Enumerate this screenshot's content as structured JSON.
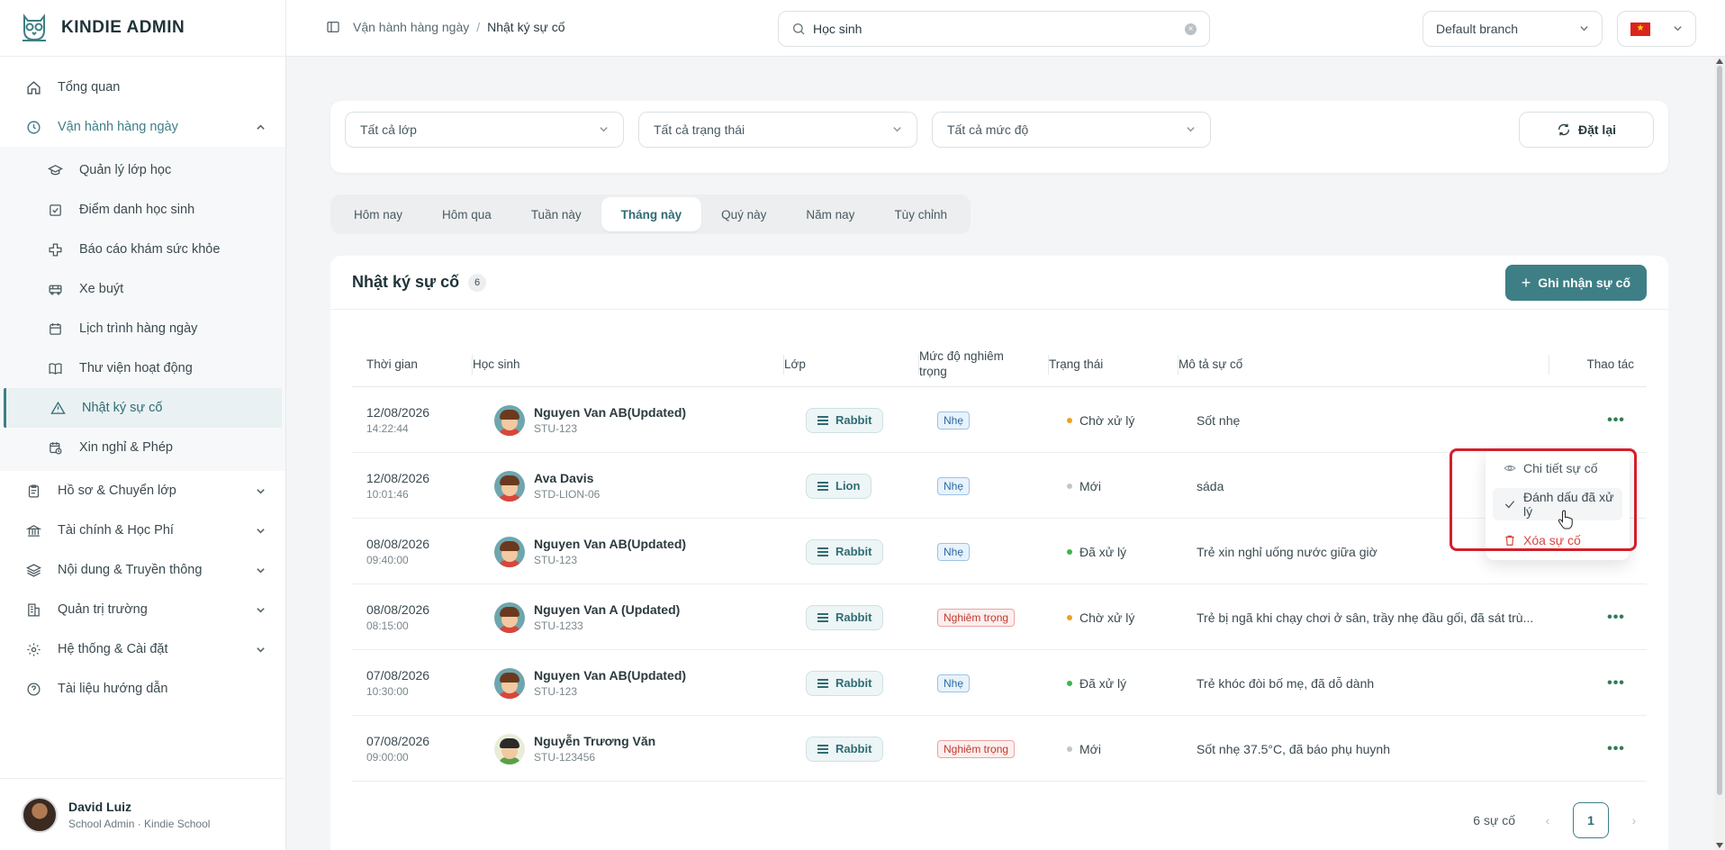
{
  "brand": {
    "name": "KINDIE ADMIN"
  },
  "sidebar": {
    "items": [
      {
        "label": "Tổng quan",
        "icon": "home-icon"
      },
      {
        "label": "Vận hành hàng ngày",
        "icon": "clock-icon",
        "open": true
      },
      {
        "label": "Hồ sơ & Chuyển lớp",
        "icon": "clipboard-icon"
      },
      {
        "label": "Tài chính & Học Phí",
        "icon": "bank-icon"
      },
      {
        "label": "Nội dung & Truyền thông",
        "icon": "layers-icon"
      },
      {
        "label": "Quản trị trường",
        "icon": "building-icon"
      },
      {
        "label": "Hệ thống & Cài đặt",
        "icon": "gear-icon"
      },
      {
        "label": "Tài liệu hướng dẫn",
        "icon": "help-icon"
      }
    ],
    "subitems": [
      {
        "label": "Quản lý lớp học",
        "icon": "graduation-cap-icon"
      },
      {
        "label": "Điểm danh học sinh",
        "icon": "checkbox-icon"
      },
      {
        "label": "Báo cáo khám sức khỏe",
        "icon": "medical-cross-icon"
      },
      {
        "label": "Xe buýt",
        "icon": "bus-icon"
      },
      {
        "label": "Lịch trình hàng ngày",
        "icon": "calendar-icon"
      },
      {
        "label": "Thư viện hoạt động",
        "icon": "book-icon"
      },
      {
        "label": "Nhật ký sự cố",
        "icon": "warning-icon",
        "active": true
      },
      {
        "label": "Xin nghỉ & Phép",
        "icon": "calendar-clock-icon"
      }
    ]
  },
  "user": {
    "name": "David Luiz",
    "role": "School Admin · Kindie School"
  },
  "topbar": {
    "breadcrumb": [
      "Vận hành hàng ngày",
      "Nhật ký sự cố"
    ],
    "search_value": "Học sinh",
    "branch": "Default branch"
  },
  "filters": {
    "class": "Tất cả lớp",
    "status": "Tất cả trạng thái",
    "severity": "Tất cả mức độ",
    "reset_label": "Đặt lại"
  },
  "periods": [
    "Hôm nay",
    "Hôm qua",
    "Tuần này",
    "Tháng này",
    "Quý này",
    "Năm nay",
    "Tùy chỉnh"
  ],
  "card": {
    "title": "Nhật ký sự cố",
    "count": "6",
    "add_label": "Ghi nhận sự cố"
  },
  "table": {
    "headers": {
      "time": "Thời gian",
      "student": "Học sinh",
      "class": "Lớp",
      "severity": "Mức độ nghiêm trọng",
      "status": "Trạng thái",
      "desc": "Mô tả sự cố",
      "actions": "Thao tác"
    },
    "rows": [
      {
        "date": "12/08/2026",
        "time": "14:22:44",
        "name": "Nguyen Van AB(Updated)",
        "code": "STU-123",
        "class": "Rabbit",
        "severity": "Nhẹ",
        "status": "Chờ xử lý",
        "desc": "Sốt nhẹ"
      },
      {
        "date": "12/08/2026",
        "time": "10:01:46",
        "name": "Ava Davis",
        "code": "STD-LION-06",
        "class": "Lion",
        "severity": "Nhẹ",
        "status": "Mới",
        "desc": "sáda"
      },
      {
        "date": "08/08/2026",
        "time": "09:40:00",
        "name": "Nguyen Van AB(Updated)",
        "code": "STU-123",
        "class": "Rabbit",
        "severity": "Nhẹ",
        "status": "Đã xử lý",
        "desc": "Trẻ xin nghỉ uống nước giữa giờ"
      },
      {
        "date": "08/08/2026",
        "time": "08:15:00",
        "name": "Nguyen Van A (Updated)",
        "code": "STU-1233",
        "class": "Rabbit",
        "severity": "Nghiêm trọng",
        "status": "Chờ xử lý",
        "desc": "Trẻ bị ngã khi chạy chơi ở sân, trầy nhẹ đầu gối, đã sát trù..."
      },
      {
        "date": "07/08/2026",
        "time": "10:30:00",
        "name": "Nguyen Van AB(Updated)",
        "code": "STU-123",
        "class": "Rabbit",
        "severity": "Nhẹ",
        "status": "Đã xử lý",
        "desc": "Trẻ khóc đòi bố mẹ, đã dỗ dành"
      },
      {
        "date": "07/08/2026",
        "time": "09:00:00",
        "name": "Nguyễn Trương Văn",
        "code": "STU-123456",
        "class": "Rabbit",
        "severity": "Nghiêm trọng",
        "status": "Mới",
        "desc": "Sốt nhẹ 37.5°C, đã báo phụ huynh"
      }
    ]
  },
  "menu": {
    "detail": "Chi tiết sự cố",
    "mark_done": "Đánh dấu đã xử lý",
    "delete": "Xóa sự cố"
  },
  "pager": {
    "total": "6 sự cố",
    "page": "1"
  },
  "colors": {
    "accent": "#3e7f86",
    "pending": "#f0a020",
    "new": "#c2c6c9",
    "done": "#3bb54a",
    "danger": "#d9453b",
    "highlight": "#d31f2a"
  }
}
